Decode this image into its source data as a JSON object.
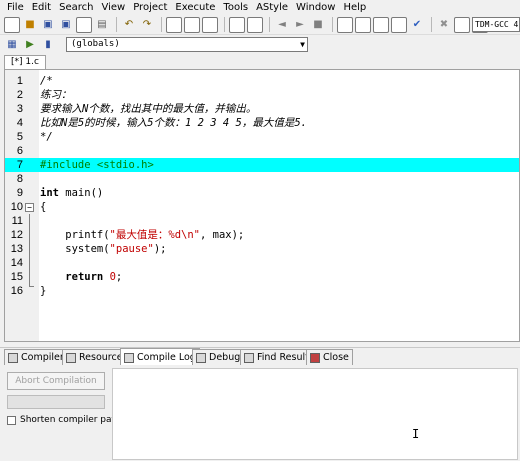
{
  "menu": [
    "File",
    "Edit",
    "Search",
    "View",
    "Project",
    "Execute",
    "Tools",
    "AStyle",
    "Window",
    "Help"
  ],
  "toolbar": {
    "compiler_value": "TDM-GCC 4",
    "scope_value": "(globals)"
  },
  "file_tab": "[*] 1.c",
  "code_lines": [
    {
      "n": "1",
      "text": "/*",
      "kind": "comment"
    },
    {
      "n": "2",
      "text": "练习：",
      "kind": "comment"
    },
    {
      "n": "3",
      "text": "要求输入N个数，找出其中的最大值，并输出。",
      "kind": "comment"
    },
    {
      "n": "4",
      "text": "比如N是5的时候，输入5个数：1 2 3 4 5，最大值是5.",
      "kind": "comment"
    },
    {
      "n": "5",
      "text": "*/",
      "kind": "comment"
    },
    {
      "n": "6",
      "text": "",
      "kind": "plain"
    },
    {
      "n": "7",
      "text": "#include <stdio.h>",
      "kind": "pre"
    },
    {
      "n": "8",
      "text": "",
      "kind": "plain"
    },
    {
      "n": "9",
      "text": "int main()",
      "kind": "plain"
    },
    {
      "n": "10",
      "text": "{",
      "kind": "plain"
    },
    {
      "n": "11",
      "text": "",
      "kind": "plain"
    },
    {
      "n": "12",
      "text": "    printf(\"最大值是：%d\\n\", max);",
      "kind": "plain"
    },
    {
      "n": "13",
      "text": "    system(\"pause\");",
      "kind": "plain"
    },
    {
      "n": "14",
      "text": "",
      "kind": "plain"
    },
    {
      "n": "15",
      "text": "    return 0;",
      "kind": "plain"
    },
    {
      "n": "16",
      "text": "}",
      "kind": "plain"
    }
  ],
  "bottom_tabs": [
    "Compiler",
    "Resources",
    "Compile Log",
    "Debug",
    "Find Results",
    "Close"
  ],
  "panel": {
    "abort_label": "Abort Compilation",
    "shorten_label": "Shorten compiler paths"
  },
  "colors": {
    "highlight_line": "#00ffff",
    "preprocessor": "#008000",
    "string": "#c00000"
  }
}
